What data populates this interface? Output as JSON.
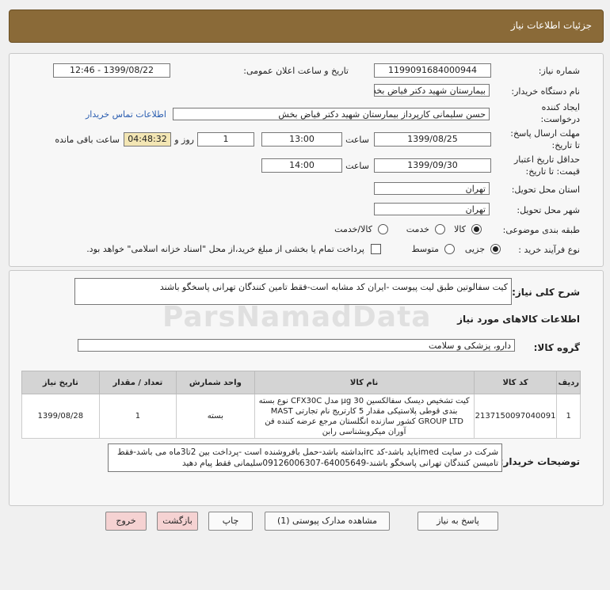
{
  "header_title": "جزئیات اطلاعات نیاز",
  "fields": {
    "need_number_label": "شماره نیاز:",
    "need_number": "1199091684000944",
    "announce_label": "تاریخ و ساعت اعلان عمومی:",
    "announce_value": "1399/08/22 - 12:46",
    "buyer_org_label": "نام دستگاه خریدار:",
    "buyer_org": "بیمارستان شهید دکتر فیاض بخش",
    "creator_label_1": "ایجاد کننده",
    "creator_label_2": "درخواست:",
    "creator": "حسن سلیمانی کارپرداز بیمارستان شهید دکتر فیاض بخش",
    "contact_link": "اطلاعات تماس خریدار",
    "deadline_label_1": "مهلت ارسال پاسخ:",
    "deadline_label_2": "تا تاریخ:",
    "deadline_date": "1399/08/25",
    "time_label": "ساعت",
    "deadline_time": "13:00",
    "days_value": "1",
    "days_label": "روز و",
    "remaining_time": "04:48:32",
    "remaining_label": "ساعت باقی مانده",
    "validity_label_1": "حداقل تاریخ اعتبار",
    "validity_label_2": "قیمت: تا تاریخ:",
    "validity_date": "1399/09/30",
    "validity_time": "14:00",
    "province_label": "استان محل تحویل:",
    "province": "تهران",
    "city_label": "شهر محل تحویل:",
    "city": "تهران",
    "category_label": "طبقه بندی موضوعی:",
    "category_options": [
      "کالا",
      "خدمت",
      "کالا/خدمت"
    ],
    "category_selected": 0,
    "process_label": "نوع فرآیند خرید :",
    "process_options": [
      "جزیی",
      "متوسط"
    ],
    "process_selected": 0,
    "payment_note": "پرداخت تمام یا بخشی از مبلغ خرید،از محل \"اسناد خزانه اسلامی\" خواهد بود."
  },
  "summary": {
    "label": "شرح کلی نیاز:",
    "text": "کیت سفالوتین طبق لیت پیوست -ایران کد مشابه است-فقط تامین کنندگان تهرانی پاسخگو باشند"
  },
  "goods_section_title": "اطلاعات کالاهای مورد نیاز",
  "group": {
    "label": "گروه کالا:",
    "value": "دارو، پزشکی و سلامت"
  },
  "table": {
    "headers": [
      "ردیف",
      "کد کالا",
      "نام کالا",
      "واحد شمارش",
      "تعداد / مقدار",
      "تاریخ نیاز"
    ],
    "rows": [
      {
        "row": "1",
        "code": "2137150097040091",
        "name": "کیت تشخیص دیسک سفالکسین 30 µg مدل CFX30C نوع بسته بندی قوطی پلاستیکی مقدار 5 کارتریج نام تجارتی MAST GROUP LTD کشور سازنده انگلستان مرجع عرضه کننده فن آوران میکروبشناسی رابن",
        "unit": "بسته",
        "qty": "1",
        "date": "1399/08/28"
      }
    ]
  },
  "buyer_notes": {
    "label": "توضیحات خریدار:",
    "text": "شرکت در سایت imedباید باشد-کد ircبداشته باشد-حمل بافروشنده است -پرداخت بین 2تا3ماه می باشد-فقط تامیسن کنندگان تهرانی پاسخگو باشند-64005649-09126006307سلیمانی فقط پیام دهید"
  },
  "buttons": {
    "reply": "پاسخ به نیاز",
    "docs": "مشاهده مدارک پیوستی (1)",
    "print": "چاپ",
    "back": "بازگشت",
    "exit": "خروج"
  },
  "colors": {
    "header_bg": "#8a6a38",
    "remaining_bg": "#f3e6b4",
    "back_bg": "#f5d2d2",
    "exit_bg": "#f5d2d2",
    "link": "#2a5db0"
  }
}
